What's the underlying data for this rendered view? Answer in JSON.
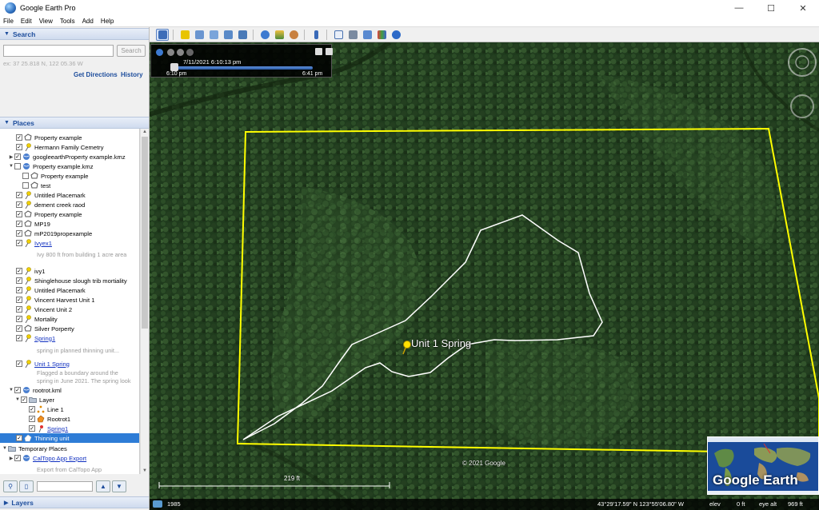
{
  "window": {
    "title": "Google Earth Pro",
    "minimize": "—",
    "maximize": "☐",
    "close": "✕"
  },
  "menu": [
    "File",
    "Edit",
    "View",
    "Tools",
    "Add",
    "Help"
  ],
  "search": {
    "header": "Search",
    "placeholder": "",
    "button": "Search",
    "hint": "ex: 37 25.818 N, 122 05.36 W",
    "get_directions": "Get Directions",
    "history": "History"
  },
  "places": {
    "header": "Places",
    "items": [
      {
        "label": "Property example"
      },
      {
        "label": "Hermann Family Cemetry"
      },
      {
        "label": "googleearthProperty example.kmz"
      },
      {
        "label": "Property example.kmz"
      },
      {
        "label": "Property example"
      },
      {
        "label": "test"
      },
      {
        "label": "Untitled Placemark"
      },
      {
        "label": "dement creek raod"
      },
      {
        "label": "Property example"
      },
      {
        "label": "MP19"
      },
      {
        "label": "mP2019propexample"
      },
      {
        "label": "Ivyex1"
      },
      {
        "label": "Ivy 800 ft from building 1 acre area"
      },
      {
        "label": "ivy1"
      },
      {
        "label": "Shinglehouse slough trib mortiality"
      },
      {
        "label": "Untitled Placemark"
      },
      {
        "label": "Vincent Harvest Unit 1"
      },
      {
        "label": "Vincent Unit 2"
      },
      {
        "label": "Mortality"
      },
      {
        "label": "Silver Porperty"
      },
      {
        "label": "Spring1"
      },
      {
        "label": "spring in planned thinning unit..."
      },
      {
        "label": "Unit 1 Spring"
      },
      {
        "label": "Flagged a boundary around the"
      },
      {
        "label": "spring in June 2021. The spring look"
      },
      {
        "label": "rootrot.kml"
      },
      {
        "label": "Layer"
      },
      {
        "label": "Line 1"
      },
      {
        "label": "Rootrot1"
      },
      {
        "label": "Spring1"
      },
      {
        "label": "Thinning unit"
      },
      {
        "label": "Temporary Places"
      },
      {
        "label": "CalTopo App Export"
      },
      {
        "label": "Export from CalTopo App"
      }
    ]
  },
  "layers": {
    "header": "Layers"
  },
  "time_slider": {
    "current": "7/11/2021   6:10:13 pm",
    "start": "6:10 pm",
    "end": "6:41 pm"
  },
  "map": {
    "placemark_label": "Unit 1 Spring",
    "copyright": "© 2021 Google",
    "scale": "219 ft",
    "logo": "Google Earth"
  },
  "status": {
    "year": "1985",
    "coords": "43°29'17.59\" N  123°55'06.80\" W",
    "elev": "elev",
    "elev_val": "0 ft",
    "eye_alt": "eye alt",
    "eye_alt_val": "969 ft"
  },
  "colors": {
    "accent": "#1d4d9c",
    "selection": "#2e7cd6",
    "boundary": "#ffff00",
    "unit_outline": "#ffffff"
  }
}
